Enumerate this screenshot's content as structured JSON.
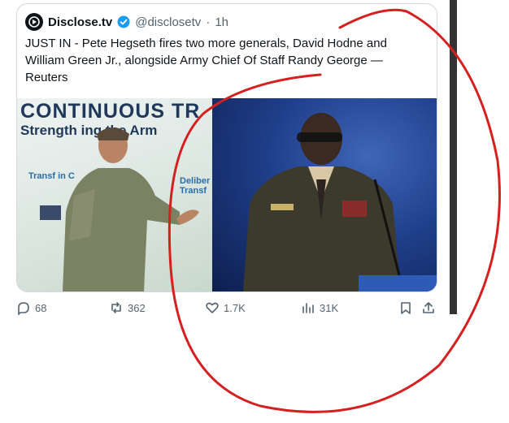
{
  "tweet": {
    "account_name": "Disclose.tv",
    "handle": "@disclosetv",
    "separator": "·",
    "time": "1h",
    "text": "JUST IN - Pete Hegseth fires two more generals, David Hodne and William Green Jr., alongside Army Chief Of Staff Randy George — Reuters"
  },
  "media": {
    "left_banner_line1": "CONTINUOUS TR",
    "left_banner_line2": "Strength  ing the Arm",
    "left_banner_line3": "Transf in C",
    "left_banner_line4": "Deliber Transf",
    "icons": [
      "photo-soldier-speaking",
      "photo-general-podium"
    ]
  },
  "actions": {
    "replies": "68",
    "reposts": "362",
    "likes": "1.7K",
    "views": "31K"
  },
  "colors": {
    "verified_blue": "#1d9bf0",
    "annotation_red": "#d61f1f",
    "muted_text": "#536471"
  }
}
